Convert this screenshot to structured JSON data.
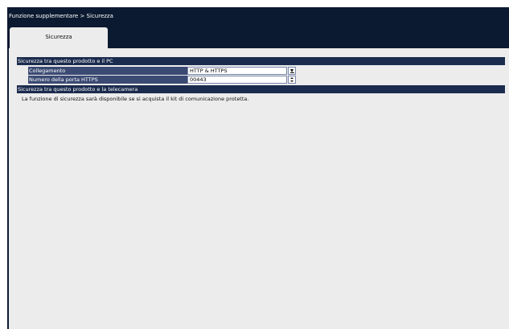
{
  "breadcrumb": "Funzione supplementare > Sicurezza",
  "tabs": [
    {
      "label": "Sicurezza"
    }
  ],
  "section_pc": {
    "header": "Sicurezza tra questo prodotto e il PC",
    "rows": [
      {
        "label": "Collegamento",
        "value": "HTTP & HTTPS",
        "control": "dropdown-icon"
      },
      {
        "label": "Numero della porta HTTPS",
        "value": "00443",
        "control": "stepper-icon"
      }
    ]
  },
  "section_camera": {
    "header": "Sicurezza tra questo prodotto e la telecamera",
    "message": "La funzione di sicurezza sarà disponibile se si acquista il kit di comunicazione protetta."
  },
  "colors": {
    "frame": "#0b1a30",
    "section_header": "#1a2b4d",
    "row_label": "#3b4a73",
    "panel": "#ececec"
  }
}
